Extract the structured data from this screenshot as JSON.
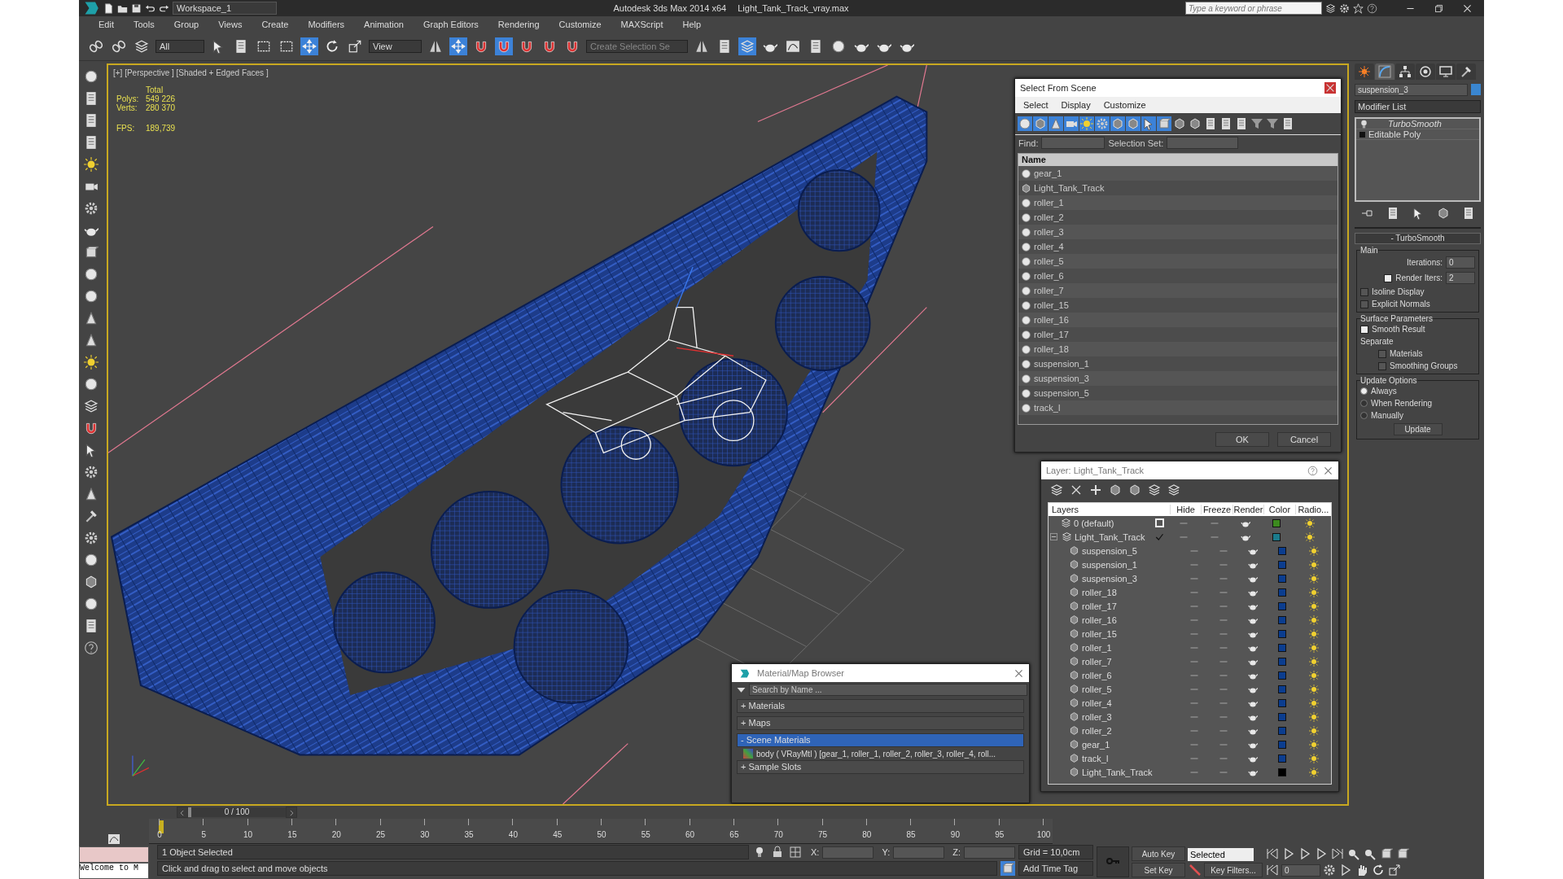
{
  "window": {
    "workspace": "Workspace_1",
    "title": "Autodesk 3ds Max  2014 x64",
    "file": "Light_Tank_Track_vray.max",
    "search_placeholder": "Type a keyword or phrase"
  },
  "menu": [
    "Edit",
    "Tools",
    "Group",
    "Views",
    "Create",
    "Modifiers",
    "Animation",
    "Graph Editors",
    "Rendering",
    "Customize",
    "MAXScript",
    "Help"
  ],
  "toolbar": {
    "selection_filter": "All",
    "reference_coordinates": "View",
    "named_selection": "Create Selection Se"
  },
  "viewport": {
    "label": "[+] [Perspective ] [Shaded + Edged Faces ]",
    "stats_heading": "Total",
    "stats": [
      {
        "label": "Polys:",
        "value": "549 226"
      },
      {
        "label": "Verts:",
        "value": "280 370"
      }
    ],
    "fps": {
      "label": "FPS:",
      "value": "189,739"
    }
  },
  "select_from_scene": {
    "title": "Select From Scene",
    "menu": [
      "Select",
      "Display",
      "Customize"
    ],
    "find_label": "Find:",
    "selection_set_label": "Selection Set:",
    "column": "Name",
    "items": [
      {
        "name": "gear_1",
        "kind": "object"
      },
      {
        "name": "Light_Tank_Track",
        "kind": "group"
      },
      {
        "name": "roller_1",
        "kind": "object"
      },
      {
        "name": "roller_2",
        "kind": "object"
      },
      {
        "name": "roller_3",
        "kind": "object"
      },
      {
        "name": "roller_4",
        "kind": "object"
      },
      {
        "name": "roller_5",
        "kind": "object"
      },
      {
        "name": "roller_6",
        "kind": "object"
      },
      {
        "name": "roller_7",
        "kind": "object"
      },
      {
        "name": "roller_15",
        "kind": "object"
      },
      {
        "name": "roller_16",
        "kind": "object"
      },
      {
        "name": "roller_17",
        "kind": "object"
      },
      {
        "name": "roller_18",
        "kind": "object"
      },
      {
        "name": "suspension_1",
        "kind": "object"
      },
      {
        "name": "suspension_3",
        "kind": "object"
      },
      {
        "name": "suspension_5",
        "kind": "object"
      },
      {
        "name": "track_l",
        "kind": "object"
      }
    ],
    "buttons": [
      "OK",
      "Cancel"
    ]
  },
  "layer_window": {
    "title": "Layer: Light_Tank_Track",
    "columns": [
      "Layers",
      "Hide",
      "Freeze",
      "Render",
      "Color",
      "Radio..."
    ],
    "rows": [
      {
        "name": "0 (default)",
        "current": false,
        "color": "#3c8a1e"
      },
      {
        "name": "Light_Tank_Track",
        "current": true,
        "color": "#1b7b8c",
        "expanded": true,
        "children": [
          {
            "name": "suspension_5",
            "color": "#0b3d8f"
          },
          {
            "name": "suspension_1",
            "color": "#0b3d8f"
          },
          {
            "name": "suspension_3",
            "color": "#0b3d8f"
          },
          {
            "name": "roller_18",
            "color": "#0b3d8f"
          },
          {
            "name": "roller_17",
            "color": "#0b3d8f"
          },
          {
            "name": "roller_16",
            "color": "#0b3d8f"
          },
          {
            "name": "roller_15",
            "color": "#0b3d8f"
          },
          {
            "name": "roller_1",
            "color": "#0b3d8f"
          },
          {
            "name": "roller_7",
            "color": "#0b3d8f"
          },
          {
            "name": "roller_6",
            "color": "#0b3d8f"
          },
          {
            "name": "roller_5",
            "color": "#0b3d8f"
          },
          {
            "name": "roller_4",
            "color": "#0b3d8f"
          },
          {
            "name": "roller_3",
            "color": "#0b3d8f"
          },
          {
            "name": "roller_2",
            "color": "#0b3d8f"
          },
          {
            "name": "gear_1",
            "color": "#0b3d8f"
          },
          {
            "name": "track_l",
            "color": "#0b3d8f"
          },
          {
            "name": "Light_Tank_Track",
            "color": "#000000"
          }
        ]
      }
    ]
  },
  "material_browser": {
    "title": "Material/Map Browser",
    "search_placeholder": "Search by Name ...",
    "sections": [
      {
        "toggle": "+",
        "label": "Materials",
        "expanded": false
      },
      {
        "toggle": "+",
        "label": "Maps",
        "expanded": false
      },
      {
        "toggle": "-",
        "label": "Scene Materials",
        "expanded": true,
        "entries": [
          "body ( VRayMtl ) [gear_1, roller_1, roller_2, roller_3, roller_4, roll..."
        ]
      },
      {
        "toggle": "+",
        "label": "Sample Slots",
        "expanded": false
      }
    ]
  },
  "command_panel": {
    "tabs": [
      {
        "kind": "create",
        "selected": false
      },
      {
        "kind": "modify",
        "selected": true
      },
      {
        "kind": "hierarchy",
        "selected": false
      },
      {
        "kind": "motion",
        "selected": false
      },
      {
        "kind": "display",
        "selected": false
      },
      {
        "kind": "utilities",
        "selected": false
      }
    ],
    "object_name": "suspension_3",
    "modifier_list": "Modifier List",
    "stack": [
      {
        "name": "TurboSmooth",
        "kind": "modifier"
      },
      {
        "name": "Editable Poly",
        "kind": "base"
      }
    ],
    "rollout": {
      "toggle": "-",
      "title": "TurboSmooth",
      "main": {
        "title": "Main",
        "iterations": {
          "label": "Iterations:",
          "value": "0"
        },
        "render_iters": {
          "label": "Render Iters:",
          "value": "2",
          "checked": true
        },
        "options": [
          {
            "label": "Isoline Display",
            "checked": false
          },
          {
            "label": "Explicit Normals",
            "checked": false
          }
        ]
      },
      "surface": {
        "title": "Surface Parameters",
        "smooth_result": {
          "label": "Smooth Result",
          "checked": true
        },
        "separate_label": "Separate",
        "options": [
          {
            "label": "Materials",
            "checked": false
          },
          {
            "label": "Smoothing Groups",
            "checked": false
          }
        ]
      },
      "update": {
        "title": "Update Options",
        "radios": [
          {
            "label": "Always",
            "selected": true
          },
          {
            "label": "When Rendering",
            "selected": false
          },
          {
            "label": "Manually",
            "selected": false
          }
        ],
        "button": "Update"
      }
    }
  },
  "timeline": {
    "position": "0 / 100",
    "level": 0,
    "ticks": [
      "0",
      "5",
      "10",
      "15",
      "20",
      "25",
      "30",
      "35",
      "40",
      "45",
      "50",
      "55",
      "60",
      "65",
      "70",
      "75",
      "80",
      "85",
      "90",
      "95",
      "100"
    ]
  },
  "status": {
    "welcome": "Welcome to M",
    "selection": "1 Object Selected",
    "prompt": "Click and drag to select and move objects",
    "x_label": "X:",
    "y_label": "Y:",
    "z_label": "Z:",
    "grid": "Grid = 10,0cm",
    "time_tag": "Add Time Tag",
    "auto_key": "Auto Key",
    "key_mode": "Selected",
    "set_key": "Set Key",
    "key_filters": "Key Filters...",
    "frame": "0"
  }
}
